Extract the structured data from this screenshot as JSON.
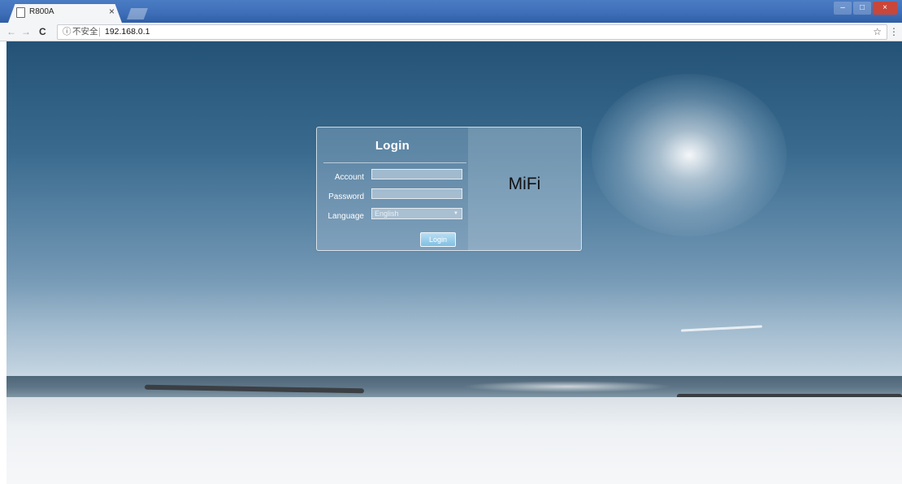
{
  "browser": {
    "tab": {
      "title": "R800A",
      "close_glyph": "×"
    },
    "window_controls": {
      "minimize": "–",
      "maximize": "□",
      "close": "×"
    },
    "toolbar": {
      "back_glyph": "←",
      "forward_glyph": "→",
      "reload_glyph": "C",
      "info_glyph": "ⓘ",
      "security_label": "不安全",
      "url": "192.168.0.1",
      "star_glyph": "☆",
      "menu_glyph": "⋮"
    }
  },
  "login": {
    "title": "Login",
    "fields": {
      "account_label": "Account",
      "account_value": "",
      "password_label": "Password",
      "password_value": "",
      "language_label": "Language",
      "language_value": "English",
      "language_arrow": "▼"
    },
    "button_label": "Login",
    "brand": "MiFi"
  },
  "icons": {
    "tab": "page-icon",
    "back": "arrow-left-icon",
    "forward": "arrow-right-icon",
    "reload": "reload-icon",
    "info": "info-icon",
    "star": "star-icon",
    "menu": "more-vertical-icon",
    "dropdown": "chevron-down-icon"
  },
  "colors": {
    "tabstrip": "#3f6fb8",
    "login_button": "#7fbfe3",
    "brand_text": "#111111"
  }
}
